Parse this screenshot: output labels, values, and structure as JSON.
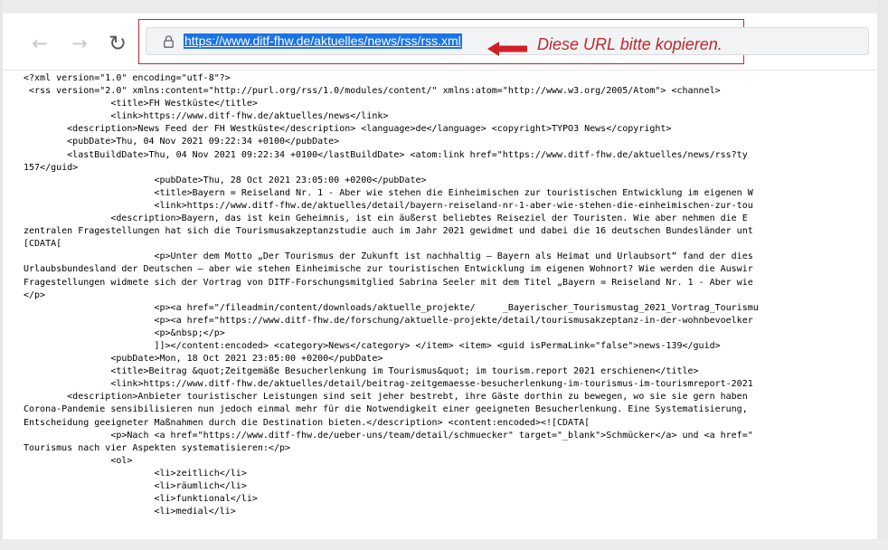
{
  "toolbar": {
    "back_icon": "back-arrow-icon",
    "forward_icon": "forward-arrow-icon",
    "reload_icon": "reload-icon",
    "security_icon": "lock-icon",
    "url": "https://www.ditf-fhw.de/aktuelles/news/rss/rss.xml",
    "annotation_text": "Diese URL bitte kopieren.",
    "accent_color": "#c0282d",
    "selection_color": "#1a73e8"
  },
  "xml_lines": [
    "<?xml version=\"1.0\" encoding=\"utf-8\"?>",
    " <rss version=\"2.0\" xmlns:content=\"http://purl.org/rss/1.0/modules/content/\" xmlns:atom=\"http://www.w3.org/2005/Atom\"> <channel>",
    "                <title>FH Westküste</title>",
    "                <link>https://www.ditf-fhw.de/aktuelles/news</link>",
    "        <description>News Feed der FH Westküste</description> <language>de</language> <copyright>TYPO3 News</copyright>",
    "        <pubDate>Thu, 04 Nov 2021 09:22:34 +0100</pubDate>",
    "        <lastBuildDate>Thu, 04 Nov 2021 09:22:34 +0100</lastBuildDate> <atom:link href=\"https://www.ditf-fhw.de/aktuelles/news/rss?ty",
    "157</guid>",
    "                        <pubDate>Thu, 28 Oct 2021 23:05:00 +0200</pubDate>",
    "                        <title>Bayern = Reiseland Nr. 1 - Aber wie stehen die Einheimischen zur touristischen Entwicklung im eigenen W",
    "                        <link>https://www.ditf-fhw.de/aktuelles/detail/bayern-reiseland-nr-1-aber-wie-stehen-die-einheimischen-zur-tou",
    "                <description>Bayern, das ist kein Geheimnis, ist ein äußerst beliebtes Reiseziel der Touristen. Wie aber nehmen die E",
    "zentralen Fragestellungen hat sich die Tourismusakzeptanzstudie auch im Jahr 2021 gewidmet und dabei die 16 deutschen Bundesländer unt",
    "[CDATA[",
    "                        <p>Unter dem Motto „Der Tourismus der Zukunft ist nachhaltig – Bayern als Heimat und Urlaubsort“ fand der dies",
    "Urlaubsbundesland der Deutschen – aber wie stehen Einheimische zur touristischen Entwicklung im eigenen Wohnort? Wie werden die Auswir",
    "Fragestellungen widmete sich der Vortrag von DITF-Forschungsmitglied Sabrina Seeler mit dem Titel „Bayern = Reiseland Nr. 1 - Aber wie",
    "</p>",
    "                        <p><a href=\"/fileadmin/content/downloads/aktuelle_projekte/     _Bayerischer_Tourismustag_2021_Vortrag_Tourismu",
    "                        <p><a href=\"https://www.ditf-fhw.de/forschung/aktuelle-projekte/detail/tourismusakzeptanz-in-der-wohnbevoelker",
    "                        <p>&nbsp;</p>",
    "                        ]]></content:encoded> <category>News</category> </item> <item> <guid isPermaLink=\"false\">news-139</guid>",
    "                <pubDate>Mon, 18 Oct 2021 23:05:00 +0200</pubDate>",
    "                <title>Beitrag &quot;Zeitgemäße Besucherlenkung im Tourismus&quot; im tourism.report 2021 erschienen</title>",
    "                <link>https://www.ditf-fhw.de/aktuelles/detail/beitrag-zeitgemaesse-besucherlenkung-im-tourismus-im-tourismreport-2021",
    "        <description>Anbieter touristischer Leistungen sind seit jeher bestrebt, ihre Gäste dorthin zu bewegen, wo sie sie gern haben",
    "Corona-Pandemie sensibilisieren nun jedoch einmal mehr für die Notwendigkeit einer geeigneten Besucherlenkung. Eine Systematisierung,",
    "Entscheidung geeigneter Maßnahmen durch die Destination bieten.</description> <content:encoded><![CDATA[",
    "                <p>Nach <a href=\"https://www.ditf-fhw.de/ueber-uns/team/detail/schmuecker\" target=\"_blank\">Schmücker</a> und <a href=\"",
    "Tourismus nach vier Aspekten systematisieren:</p>",
    "                <ol>",
    "                        <li>zeitlich</li>",
    "                        <li>räumlich</li>",
    "                        <li>funktional</li>",
    "                        <li>medial</li>"
  ]
}
